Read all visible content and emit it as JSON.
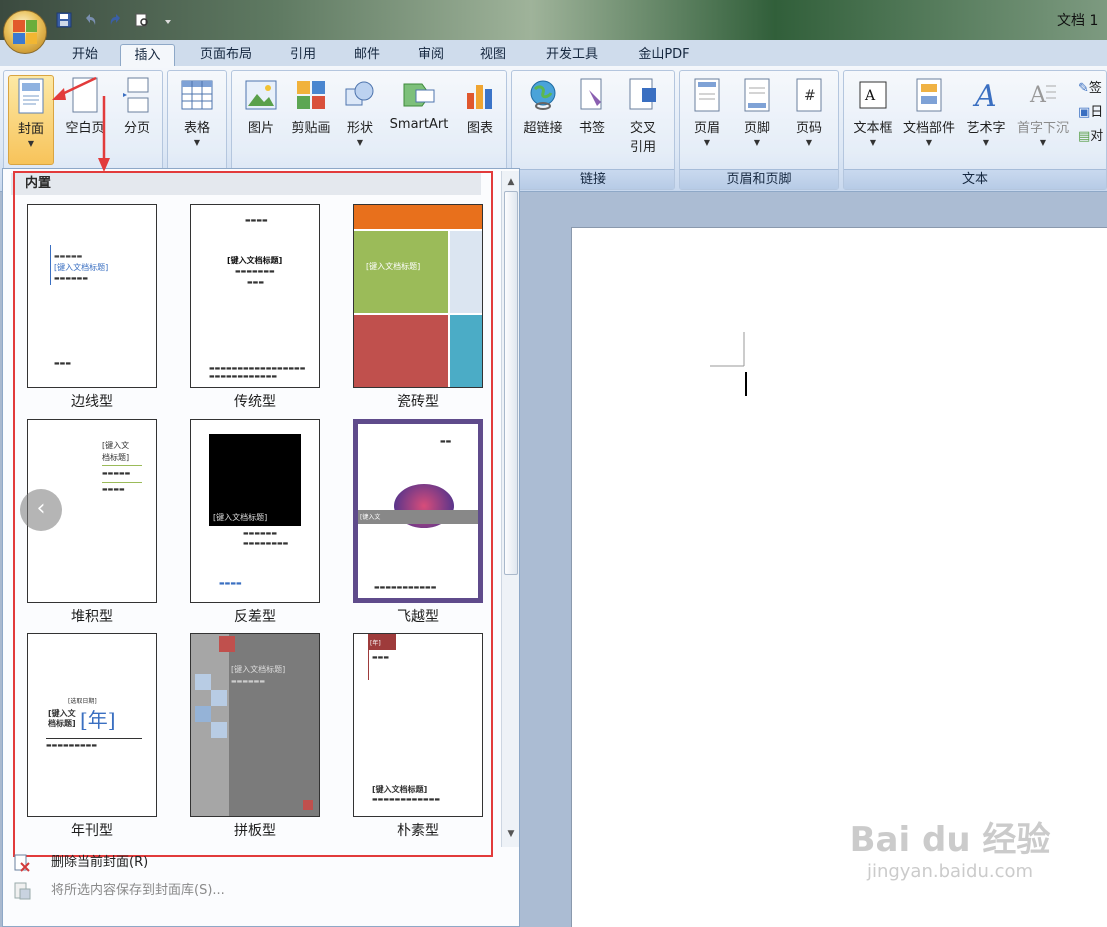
{
  "window": {
    "title": "文档 1"
  },
  "tabs": [
    {
      "label": "开始"
    },
    {
      "label": "插入"
    },
    {
      "label": "页面布局"
    },
    {
      "label": "引用"
    },
    {
      "label": "邮件"
    },
    {
      "label": "审阅"
    },
    {
      "label": "视图"
    },
    {
      "label": "开发工具"
    },
    {
      "label": "金山PDF"
    }
  ],
  "ribbon": {
    "pages": {
      "cover": "封面",
      "blank": "空白页",
      "break": "分页"
    },
    "table": {
      "table": "表格"
    },
    "illustrations": {
      "picture": "图片",
      "clipart": "剪贴画",
      "shape": "形状",
      "smartart": "SmartArt",
      "chart": "图表"
    },
    "links": {
      "hyperlink": "超链接",
      "bookmark": "书签",
      "crossref_line1": "交叉",
      "crossref_line2": "引用",
      "label": "链接"
    },
    "header_footer": {
      "header": "页眉",
      "footer": "页脚",
      "page_number": "页码",
      "label": "页眉和页脚"
    },
    "text": {
      "textbox": "文本框",
      "quickparts": "文档部件",
      "wordart": "艺术字",
      "dropcap": "首字下沉",
      "label": "文本",
      "extra1": "签",
      "extra2": "日",
      "extra3": "对"
    }
  },
  "gallery": {
    "header": "内置",
    "thumb_text": {
      "title_placeholder": "[键入文档标题]",
      "title_line1": "[键入文",
      "title_line2": "档标题]",
      "year": "[年]",
      "year_small": "[选取日期]"
    },
    "items": [
      {
        "label": "边线型"
      },
      {
        "label": "传统型"
      },
      {
        "label": "瓷砖型"
      },
      {
        "label": "堆积型"
      },
      {
        "label": "反差型"
      },
      {
        "label": "飞越型"
      },
      {
        "label": "年刊型"
      },
      {
        "label": "拼板型"
      },
      {
        "label": "朴素型"
      }
    ],
    "menu": {
      "remove": "删除当前封面(R)",
      "save": "将所选内容保存到封面库(S)..."
    }
  },
  "watermark": {
    "main": "Bai du 经验",
    "sub": "jingyan.baidu.com"
  },
  "colors": {
    "accent": "#e23b3b",
    "ribbon": "#dce7f5",
    "highlight": "#f7c35a"
  }
}
